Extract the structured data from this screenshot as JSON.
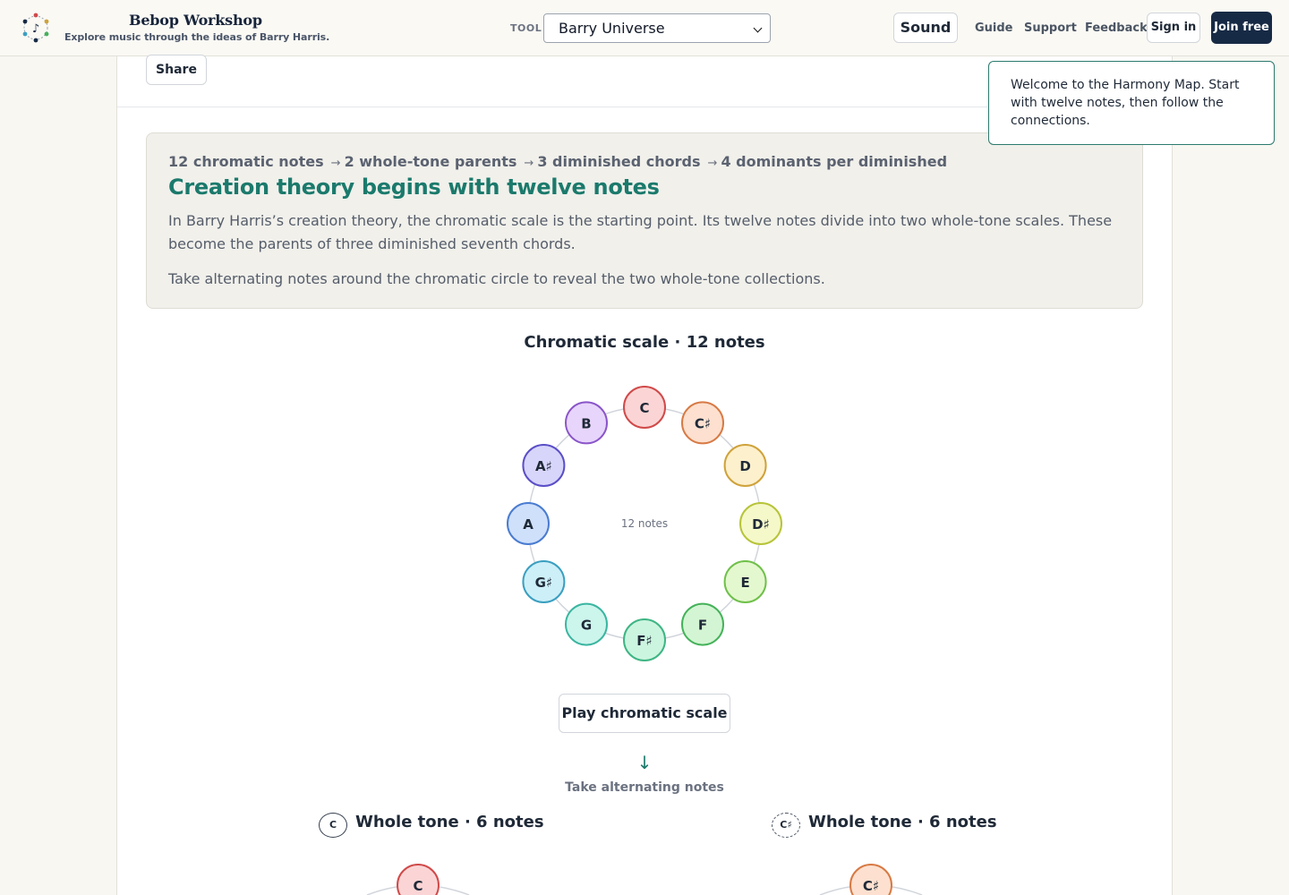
{
  "header": {
    "brand_title": "Bebop Workshop",
    "brand_subtitle": "Explore music through the ideas of Barry Harris.",
    "tool_label": "TOOL",
    "tool_selected": "Barry Universe",
    "sound_label": "Sound",
    "nav": [
      "Guide",
      "Support",
      "Feedback"
    ],
    "sign_in_label": "Sign in",
    "join_label": "Join free"
  },
  "toolbar": {
    "share_label": "Share"
  },
  "tooltip": {
    "text": "Welcome to the Harmony Map. Start with twelve notes, then follow the connections."
  },
  "intro": {
    "steps": [
      "12 chromatic notes",
      "2 whole-tone parents",
      "3 diminished chords",
      "4 dominants per diminished"
    ],
    "step_arrow": "→",
    "title": "Creation theory begins with twelve notes",
    "paragraph_1": "In Barry Harris’s creation theory, the chromatic scale is the starting point. Its twelve notes divide into two whole-tone scales. These become the parents of three diminished seventh chords.",
    "paragraph_2": "Take alternating notes around the chromatic circle to reveal the two whole-tone collections."
  },
  "chromatic": {
    "title": "Chromatic scale · 12 notes",
    "center_label": "12 notes",
    "notes": [
      {
        "name": "C",
        "fill": "#fbd5d5",
        "stroke": "#d04a4a"
      },
      {
        "name": "C♯",
        "fill": "#fde0cf",
        "stroke": "#d77a45"
      },
      {
        "name": "D",
        "fill": "#fdf0cc",
        "stroke": "#cfa23a"
      },
      {
        "name": "D♯",
        "fill": "#f5f8c9",
        "stroke": "#b7c43a"
      },
      {
        "name": "E",
        "fill": "#e4f8cf",
        "stroke": "#6fc04a"
      },
      {
        "name": "F",
        "fill": "#d3f5d3",
        "stroke": "#45b25a"
      },
      {
        "name": "F♯",
        "fill": "#ccf5e0",
        "stroke": "#3fb584"
      },
      {
        "name": "G",
        "fill": "#ccf5ec",
        "stroke": "#3ab5a0"
      },
      {
        "name": "G♯",
        "fill": "#cdeff8",
        "stroke": "#3a9fc0"
      },
      {
        "name": "A",
        "fill": "#cfe0fb",
        "stroke": "#4a7cd0"
      },
      {
        "name": "A♯",
        "fill": "#d8d5fb",
        "stroke": "#5a4fc7"
      },
      {
        "name": "B",
        "fill": "#e8d5fb",
        "stroke": "#8a55c9"
      }
    ],
    "play_label": "Play chromatic scale"
  },
  "transition": {
    "arrow": "↓",
    "label": "Take alternating notes"
  },
  "whole_tone": [
    {
      "badge": "C",
      "title": "Whole tone · 6 notes",
      "first_note": "C",
      "fill": "#fbd5d5",
      "stroke": "#d04a4a"
    },
    {
      "badge": "C♯",
      "title": "Whole tone · 6 notes",
      "first_note": "C♯",
      "fill": "#fde0cf",
      "stroke": "#d77a45"
    }
  ]
}
